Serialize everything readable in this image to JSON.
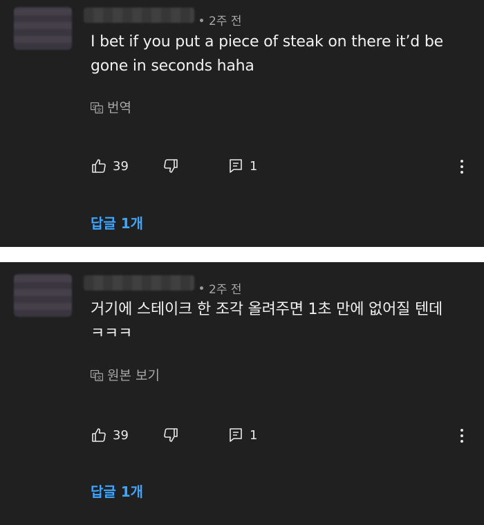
{
  "comments": [
    {
      "time": "2주 전",
      "text_line1": "I bet if you put a piece of steak on there it’d be",
      "text_line2": "gone in seconds haha",
      "translate_label": "번역",
      "likes": "39",
      "reply_count": "1",
      "replies_link": "답글 1개"
    },
    {
      "time": "2주 전",
      "text_line1": "거기에 스테이크 한 조각 올려주면 1초 만에 없어질 텐데",
      "text_line2": "ㅋㅋㅋ",
      "translate_label": "원본 보기",
      "likes": "39",
      "reply_count": "1",
      "replies_link": "답글 1개"
    }
  ],
  "icons": {
    "translate": "translate-icon",
    "like": "thumbs-up-icon",
    "dislike": "thumbs-down-icon",
    "reply": "comment-icon",
    "more": "more-vertical-icon"
  },
  "colors": {
    "background": "#202020",
    "separator": "#ffffff",
    "link": "#3ea6ff",
    "secondary_text": "#a8a8a8"
  }
}
